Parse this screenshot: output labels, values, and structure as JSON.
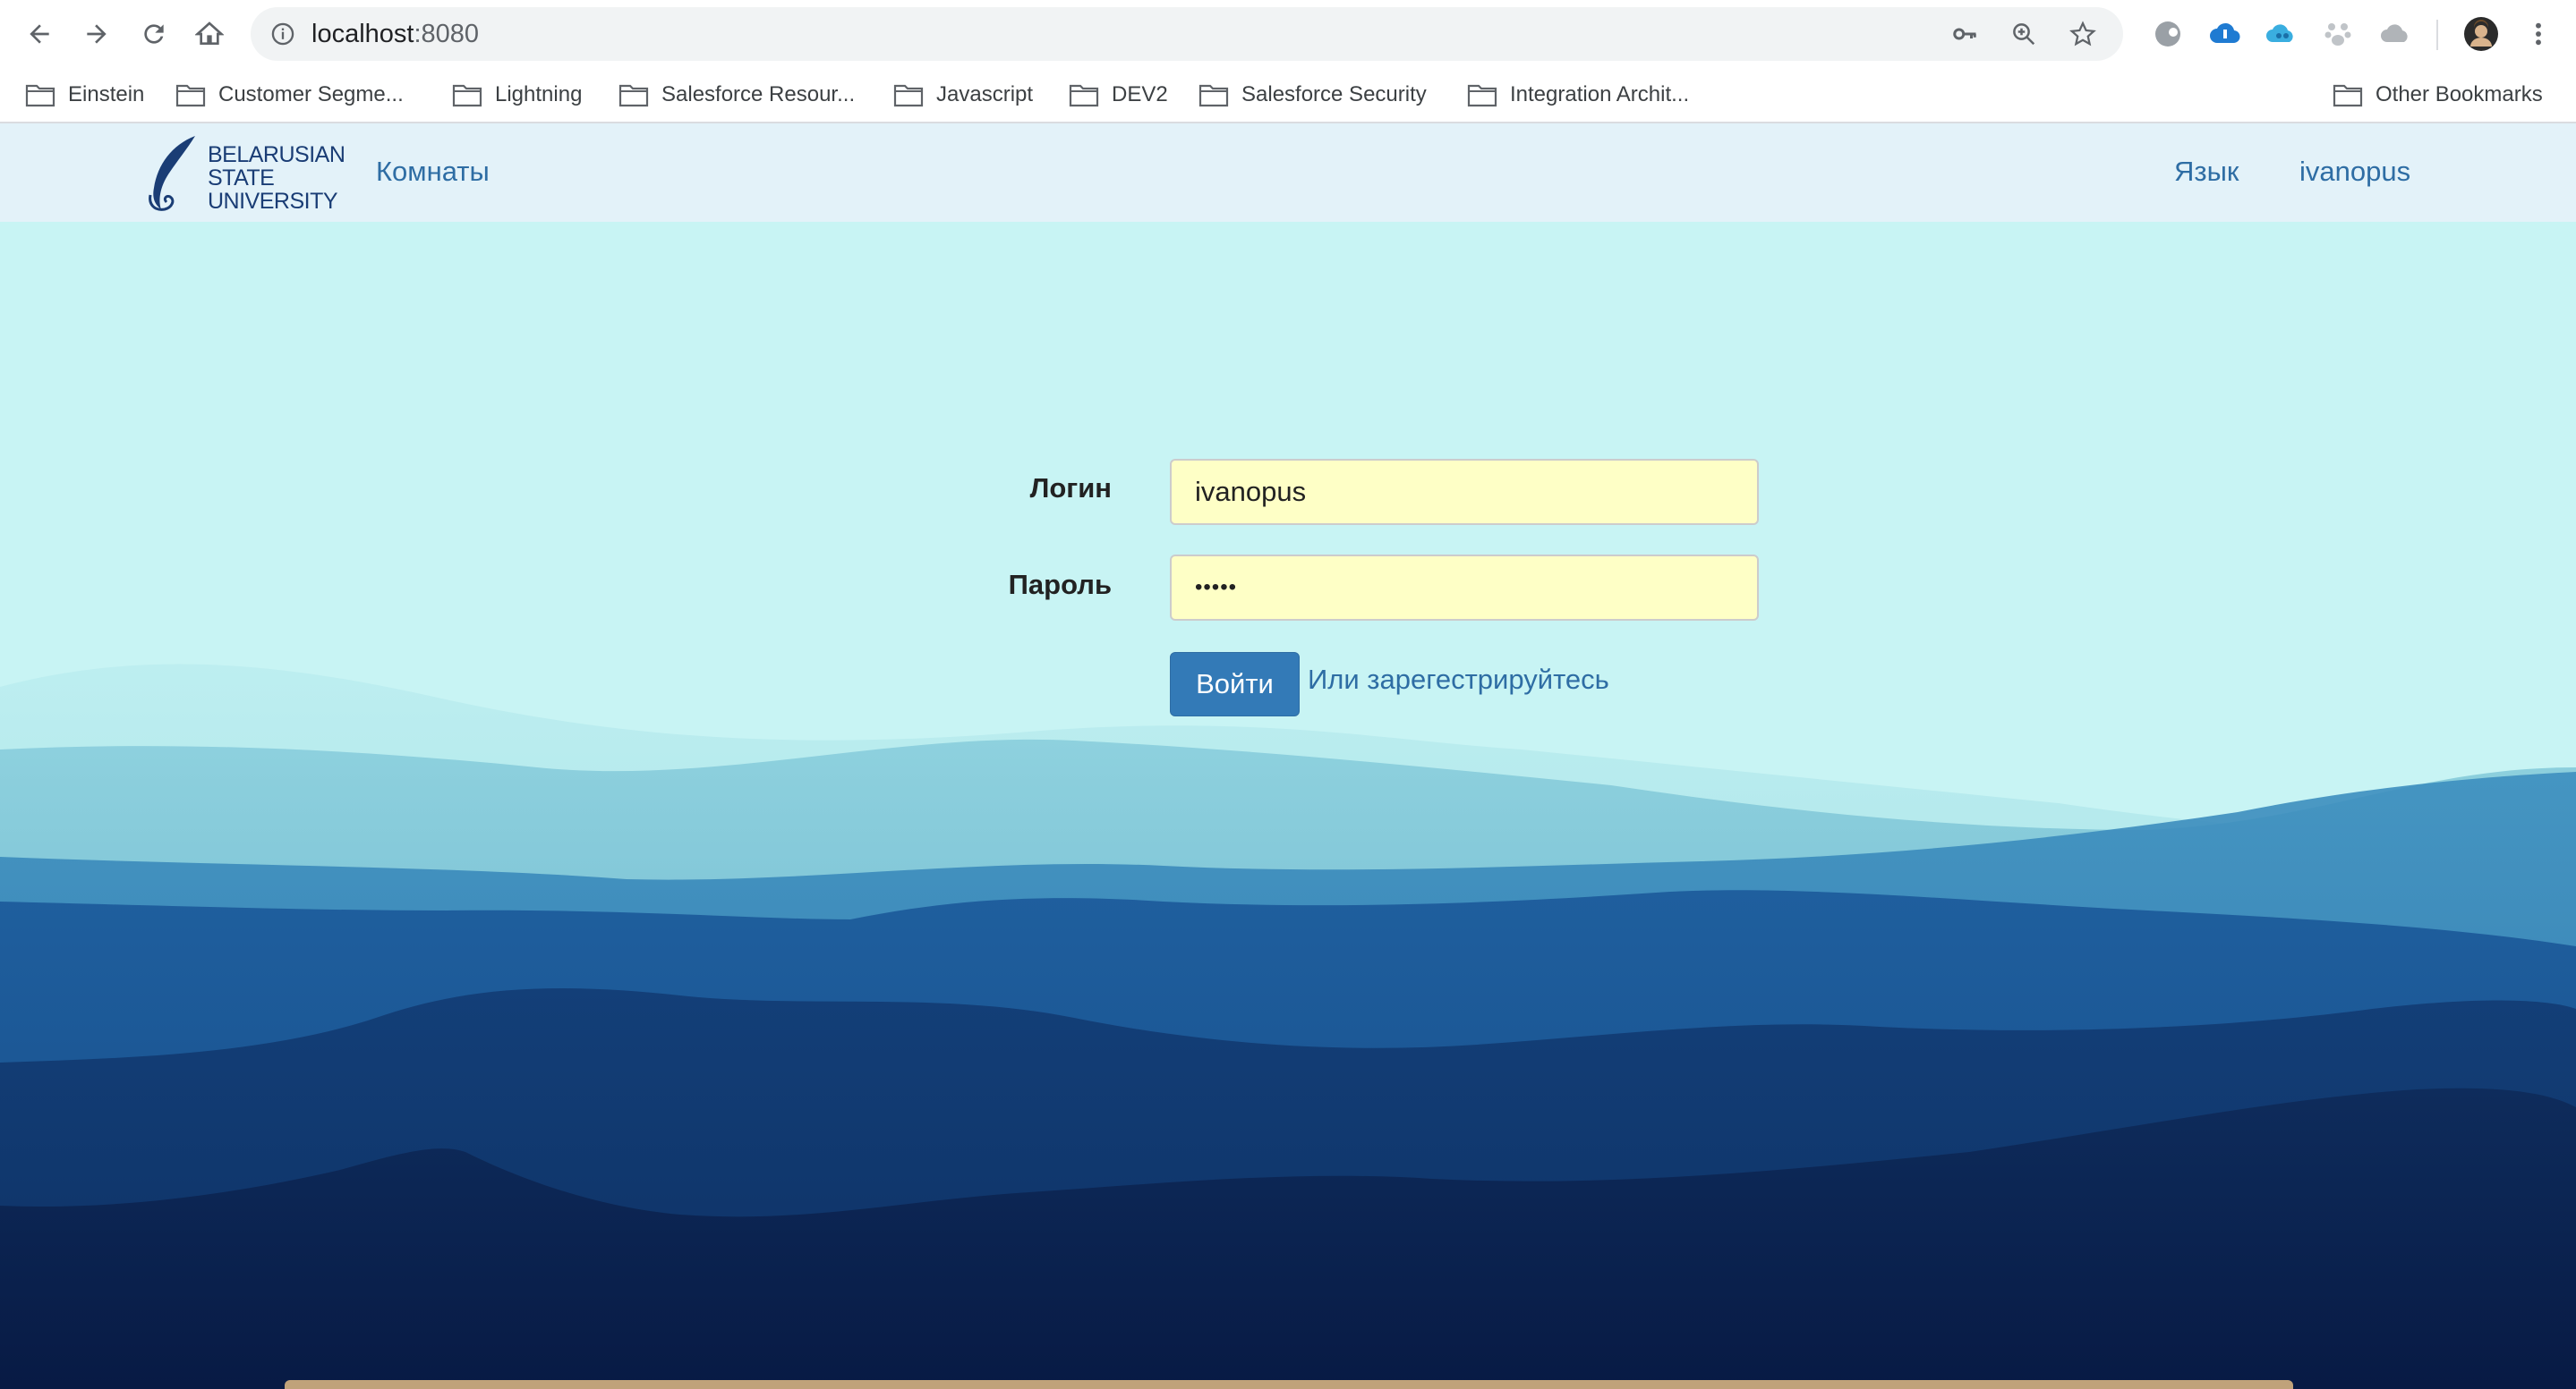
{
  "browser": {
    "url_host": "localhost",
    "url_port": ":8080",
    "icons": {
      "back": "back-arrow-icon",
      "forward": "forward-arrow-icon",
      "reload": "reload-icon",
      "home": "home-icon",
      "info": "info-icon",
      "key": "key-icon",
      "zoom": "zoom-icon",
      "star": "bookmark-star-icon",
      "menu": "kebab-menu-icon"
    },
    "bookmarks": [
      {
        "label": "Einstein"
      },
      {
        "label": "Customer Segme..."
      },
      {
        "label": "Lightning"
      },
      {
        "label": "Salesforce Resour..."
      },
      {
        "label": "Javascript"
      },
      {
        "label": "DEV2"
      },
      {
        "label": "Salesforce Security"
      },
      {
        "label": "Integration Archit..."
      }
    ],
    "other_bookmarks": "Other Bookmarks"
  },
  "navbar": {
    "logo_lines": [
      "BELARUSIAN",
      "STATE",
      "UNIVERSITY"
    ],
    "rooms_link": "Комнаты",
    "language_link": "Язык",
    "user_link": "ivanopus"
  },
  "form": {
    "login_label": "Логин",
    "login_value": "ivanopus",
    "password_label": "Пароль",
    "password_value": "•••••",
    "submit_label": "Войти",
    "register_link": "Или зарегестрируйтесь"
  },
  "colors": {
    "sky": "#c8f4f4",
    "navbar": "#e3f2f9",
    "link": "#2e6da4",
    "button": "#337ab7",
    "input_bg": "#feffc6",
    "mountain_dark": "#0b1e4a"
  }
}
